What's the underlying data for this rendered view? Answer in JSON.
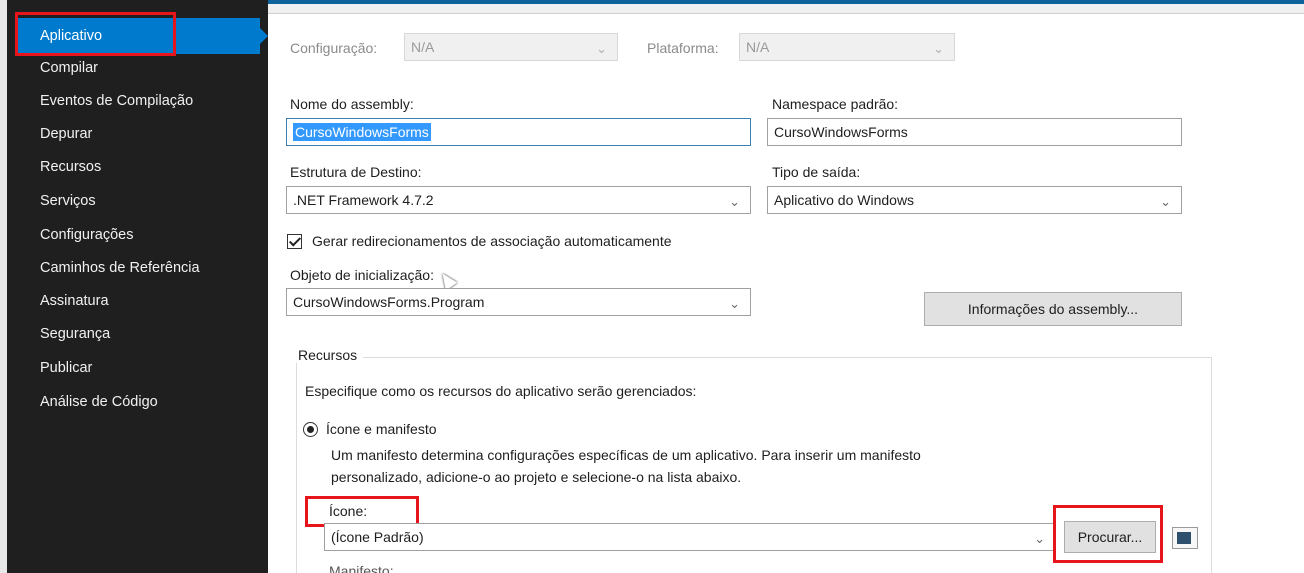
{
  "nav": {
    "items": [
      {
        "label": "Aplicativo"
      },
      {
        "label": "Compilar"
      },
      {
        "label": "Eventos de Compilação"
      },
      {
        "label": "Depurar"
      },
      {
        "label": "Recursos"
      },
      {
        "label": "Serviços"
      },
      {
        "label": "Configurações"
      },
      {
        "label": "Caminhos de Referência"
      },
      {
        "label": "Assinatura"
      },
      {
        "label": "Segurança"
      },
      {
        "label": "Publicar"
      },
      {
        "label": "Análise de Código"
      }
    ],
    "selected_index": 0
  },
  "config": {
    "configuracao_label": "Configuração:",
    "configuracao_value": "N/A",
    "plataforma_label": "Plataforma:",
    "plataforma_value": "N/A"
  },
  "form": {
    "assembly_name_label": "Nome do assembly:",
    "assembly_name_value": "CursoWindowsForms",
    "namespace_label": "Namespace padrão:",
    "namespace_value": "CursoWindowsForms",
    "target_framework_label": "Estrutura de Destino:",
    "target_framework_value": ".NET Framework 4.7.2",
    "output_type_label": "Tipo de saída:",
    "output_type_value": "Aplicativo do Windows",
    "auto_redirect_label": "Gerar redirecionamentos de associação automaticamente",
    "auto_redirect_checked": true,
    "startup_object_label": "Objeto de inicialização:",
    "startup_object_value": "CursoWindowsForms.Program",
    "assembly_info_button": "Informações do assembly..."
  },
  "resources": {
    "group_title": "Recursos",
    "description": "Especifique como os recursos do aplicativo serão gerenciados:",
    "radio_label": "Ícone e manifesto",
    "radio_selected": true,
    "manifest_help_line1": "Um manifesto determina configurações específicas de um aplicativo. Para inserir um manifesto",
    "manifest_help_line2": "personalizado, adicione-o ao projeto e selecione-o na lista abaixo.",
    "icon_label": "Ícone:",
    "icon_value": "(Ícone Padrão)",
    "browse_button": "Procurar...",
    "manifest_label": "Manifesto:"
  },
  "colors": {
    "nav_background": "#1f1f1f",
    "nav_selected": "#007acc",
    "highlight_box": "#e8141c",
    "text_selection": "#3399ff"
  }
}
